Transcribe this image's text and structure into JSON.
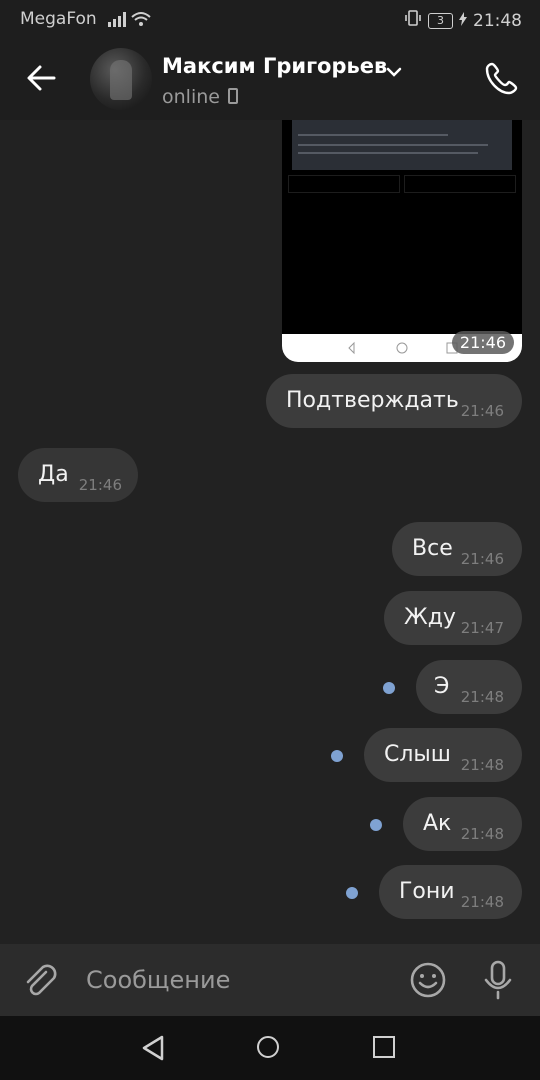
{
  "statusbar": {
    "carrier": "MegaFon",
    "battery": "3",
    "time": "21:48"
  },
  "header": {
    "name": "Максим Григорьев",
    "status": "online"
  },
  "screenshot_attachment": {
    "time": "21:46"
  },
  "messages": [
    {
      "text": "Подтверждать",
      "time": "21:46",
      "dir": "out"
    },
    {
      "text": "Да",
      "time": "21:46",
      "dir": "in"
    },
    {
      "text": "Все",
      "time": "21:46",
      "dir": "out"
    },
    {
      "text": "Жду",
      "time": "21:47",
      "dir": "out"
    },
    {
      "text": "Э",
      "time": "21:48",
      "dir": "out",
      "unread": true
    },
    {
      "text": "Слыш",
      "time": "21:48",
      "dir": "out",
      "unread": true
    },
    {
      "text": "Ак",
      "time": "21:48",
      "dir": "out",
      "unread": true
    },
    {
      "text": "Гони",
      "time": "21:48",
      "dir": "out",
      "unread": true
    }
  ],
  "composer": {
    "placeholder": "Сообщение"
  },
  "colors": {
    "background": "#222222",
    "bubble_out": "#3c3c3c",
    "bubble_in": "#363636",
    "unread_dot": "#7fa2d2"
  },
  "icons": [
    "back-arrow-icon",
    "chevron-down-icon",
    "phone-call-icon",
    "attach-paperclip-icon",
    "emoji-icon",
    "microphone-icon",
    "nav-back-icon",
    "nav-home-icon",
    "nav-recents-icon"
  ]
}
